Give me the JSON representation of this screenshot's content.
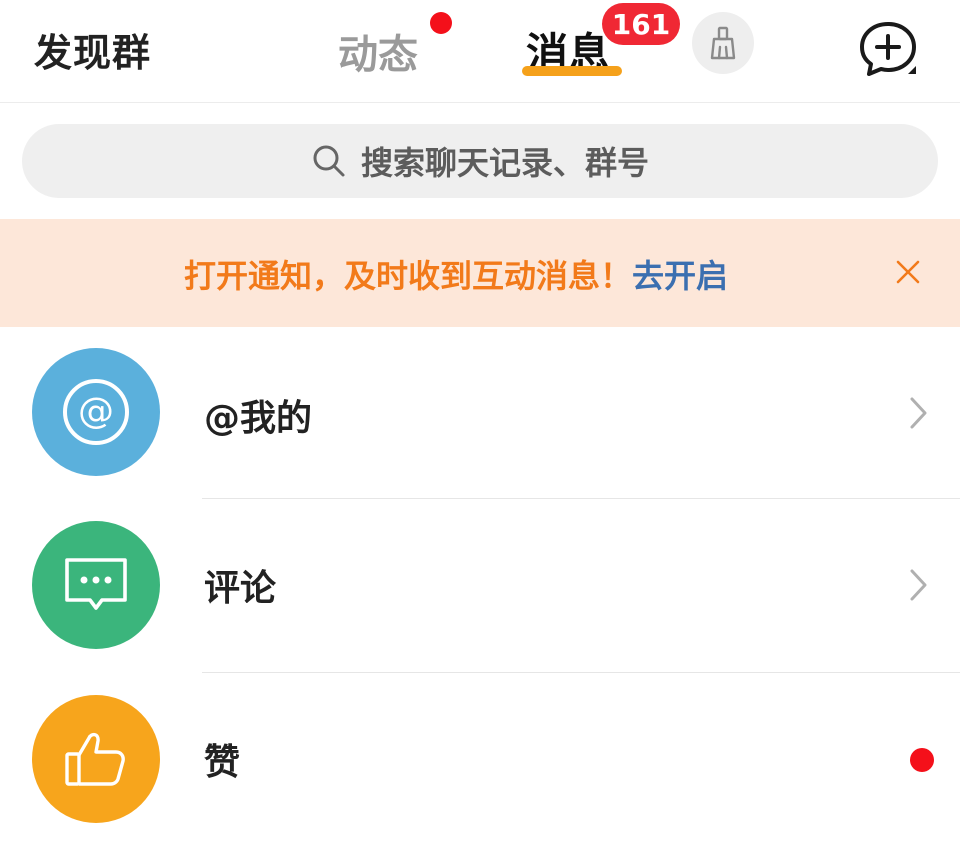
{
  "header": {
    "left_title": "发现群",
    "tabs": [
      {
        "label": "动态",
        "has_dot": true
      },
      {
        "label": "消息",
        "badge": "161",
        "active": true
      }
    ],
    "icons": [
      "broom-icon",
      "add-chat-icon"
    ],
    "accent_color": "#f5a11b",
    "badge_color": "#f02834"
  },
  "search": {
    "placeholder": "搜索聊天记录、群号",
    "icon": "search-icon"
  },
  "notice": {
    "message": "打开通知，及时收到互动消息！",
    "link": "去开启",
    "close_icon": "close-icon",
    "bg_color": "#fde7d9",
    "text_color": "#f27a1a",
    "link_color": "#3b6fb0"
  },
  "list": {
    "items": [
      {
        "label": "@我的",
        "icon": "at-icon",
        "color": "#5bb0dc",
        "trailing": "chevron"
      },
      {
        "label": "评论",
        "icon": "comment-icon",
        "color": "#3bb57c",
        "trailing": "chevron"
      },
      {
        "label": "赞",
        "icon": "thumbs-up-icon",
        "color": "#f7a51c",
        "trailing": "red-dot"
      }
    ]
  }
}
